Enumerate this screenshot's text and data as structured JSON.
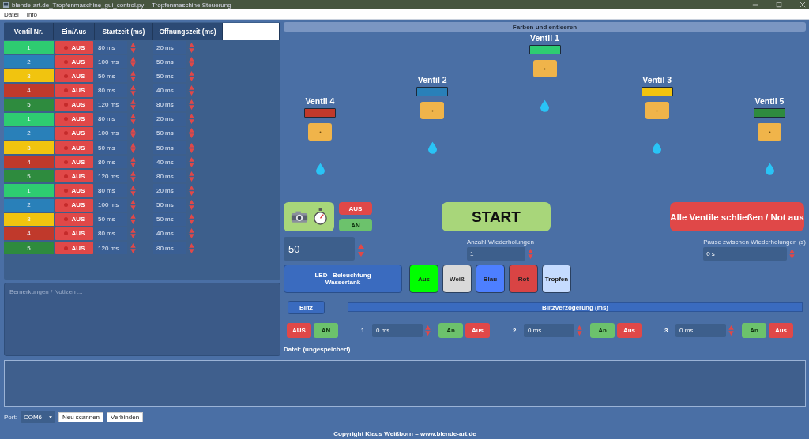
{
  "window": {
    "title": "blende-art.de_Tropfenmaschine_gui_control.py -- Tropfenmaschine Steuerung"
  },
  "menu": [
    "Datei",
    "Info"
  ],
  "table": {
    "columns": [
      "Ventil Nr.",
      "Ein/Aus",
      "Startzeit (ms)",
      "Öffnungszeit (ms)"
    ],
    "rows": [
      {
        "valve": "1",
        "color": "#2ecc71",
        "switch": "AUS",
        "on": false,
        "start": "80 ms",
        "duration": "20 ms"
      },
      {
        "valve": "2",
        "color": "#2980b9",
        "switch": "AUS",
        "on": false,
        "start": "100 ms",
        "duration": "50 ms"
      },
      {
        "valve": "3",
        "color": "#f1c40f",
        "switch": "AUS",
        "on": false,
        "start": "50 ms",
        "duration": "50 ms"
      },
      {
        "valve": "4",
        "color": "#c0392b",
        "switch": "AUS",
        "on": false,
        "start": "80 ms",
        "duration": "40 ms"
      },
      {
        "valve": "5",
        "color": "#2e8b3e",
        "switch": "AUS",
        "on": false,
        "start": "120 ms",
        "duration": "80 ms"
      },
      {
        "valve": "1",
        "color": "#2ecc71",
        "switch": "AUS",
        "on": false,
        "start": "80 ms",
        "duration": "20 ms"
      },
      {
        "valve": "2",
        "color": "#2980b9",
        "switch": "AUS",
        "on": false,
        "start": "100 ms",
        "duration": "50 ms"
      },
      {
        "valve": "3",
        "color": "#f1c40f",
        "switch": "AUS",
        "on": false,
        "start": "50 ms",
        "duration": "50 ms"
      },
      {
        "valve": "4",
        "color": "#c0392b",
        "switch": "AUS",
        "on": false,
        "start": "80 ms",
        "duration": "40 ms"
      },
      {
        "valve": "5",
        "color": "#2e8b3e",
        "switch": "AUS",
        "on": false,
        "start": "120 ms",
        "duration": "80 ms"
      },
      {
        "valve": "1",
        "color": "#2ecc71",
        "switch": "AUS",
        "on": false,
        "start": "80 ms",
        "duration": "20 ms"
      },
      {
        "valve": "2",
        "color": "#2980b9",
        "switch": "AUS",
        "on": false,
        "start": "100 ms",
        "duration": "50 ms"
      },
      {
        "valve": "3",
        "color": "#f1c40f",
        "switch": "AUS",
        "on": false,
        "start": "50 ms",
        "duration": "50 ms"
      },
      {
        "valve": "4",
        "color": "#c0392b",
        "switch": "AUS",
        "on": false,
        "start": "80 ms",
        "duration": "40 ms"
      },
      {
        "valve": "5",
        "color": "#2e8b3e",
        "switch": "AUS",
        "on": false,
        "start": "120 ms",
        "duration": "80 ms"
      }
    ]
  },
  "notes": {
    "placeholder": "Bemerkungen / Notizen ..."
  },
  "valve_panel": {
    "title": "Farben und entleeren",
    "valves": [
      {
        "label": "Ventil 4",
        "color": "#c0392b"
      },
      {
        "label": "Ventil 2",
        "color": "#2980b9"
      },
      {
        "label": "Ventil 1",
        "color": "#2ecc71"
      },
      {
        "label": "Ventil 3",
        "color": "#f1c40f"
      },
      {
        "label": "Ventil 5",
        "color": "#2e8b3e"
      }
    ]
  },
  "camera": {
    "off": "AUS",
    "on": "AN"
  },
  "start": "START",
  "emergency": "Alle Ventile schließen / Not aus",
  "value_field": "50",
  "repetitions": {
    "label": "Anzahl Wiederholungen",
    "value": "1"
  },
  "pause": {
    "label": "Pause zwischen Wiederholungen (s)",
    "value": "0 s"
  },
  "led": {
    "label": "LED –Beleuchtung\nWassertank",
    "buttons": [
      {
        "label": "Aus",
        "color": "#00ff00"
      },
      {
        "label": "Weiß",
        "color": "#d9d9d9"
      },
      {
        "label": "Blau",
        "color": "#4d7fff"
      },
      {
        "label": "Rot",
        "color": "#d94444"
      },
      {
        "label": "Tropfen",
        "color": "#c5dbff"
      }
    ]
  },
  "flash": {
    "button": "Blitz",
    "delay_title": "Blitzverzögerung (ms)",
    "off": "AUS",
    "on": "AN",
    "channels": [
      {
        "number": "1",
        "value": "0 ms",
        "on": "An",
        "off": "Aus"
      },
      {
        "number": "2",
        "value": "0 ms",
        "on": "An",
        "off": "Aus"
      },
      {
        "number": "3",
        "value": "0 ms",
        "on": "An",
        "off": "Aus"
      }
    ]
  },
  "file_label": "Datei: (ungespeichert)",
  "port": {
    "label": "Port:",
    "value": "COM6",
    "buttons": [
      "Neu scannen",
      "Verbinden"
    ]
  },
  "copyright": "Copyright Klaus Weißborn – www.blende-art.de"
}
